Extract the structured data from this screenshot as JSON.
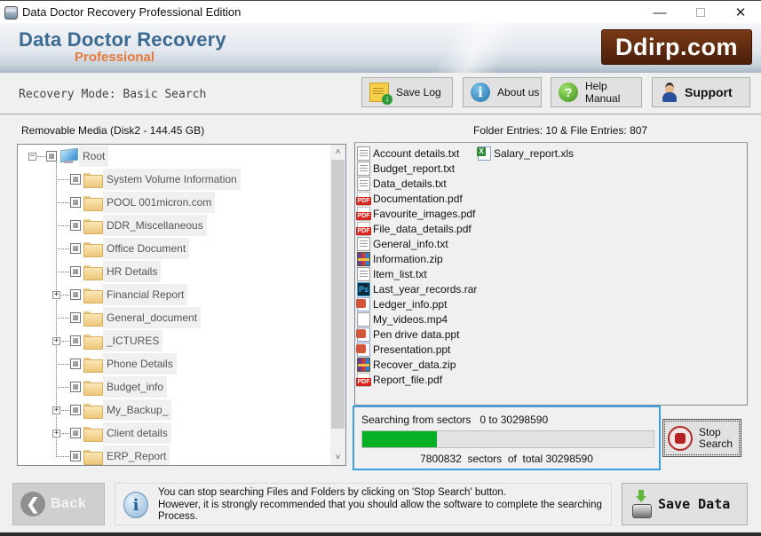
{
  "window": {
    "title": "Data Doctor Recovery Professional Edition",
    "controls": {
      "minimize": "—",
      "close": "✕"
    }
  },
  "banner": {
    "brand_main": "Data Doctor Recovery",
    "brand_sub": "Professional",
    "site_badge": "Ddirp.com"
  },
  "toolbar": {
    "mode_label": "Recovery Mode: Basic Search",
    "save_log": "Save Log",
    "about_us": "About us",
    "help_manual": "Help Manual",
    "support": "Support",
    "icons": {
      "save_log": "document-download-icon",
      "about_us": "info-icon",
      "help_manual": "help-icon",
      "support": "support-person-icon"
    }
  },
  "tree": {
    "header": "Removable Media (Disk2 - 144.45 GB)",
    "root": {
      "label": "Root",
      "expander": "−"
    },
    "items": [
      {
        "label": "System Volume Information",
        "expandable": false
      },
      {
        "label": "POOL 001micron.com",
        "expandable": false
      },
      {
        "label": "DDR_Miscellaneous",
        "expandable": false
      },
      {
        "label": "Office Document",
        "expandable": false
      },
      {
        "label": "HR Details",
        "expandable": false
      },
      {
        "label": "Financial Report",
        "expandable": true
      },
      {
        "label": "General_document",
        "expandable": false
      },
      {
        "label": "_ICTURES",
        "expandable": true
      },
      {
        "label": "Phone Details",
        "expandable": false
      },
      {
        "label": "Budget_info",
        "expandable": false
      },
      {
        "label": "My_Backup_",
        "expandable": true
      },
      {
        "label": "Client details",
        "expandable": true
      },
      {
        "label": "ERP_Report",
        "expandable": false
      }
    ],
    "expand_glyph": "+",
    "scroll_up": "˄",
    "scroll_down": "˅"
  },
  "files": {
    "summary": "Folder Entries: 10 & File Entries: 807",
    "columns": [
      [
        {
          "name": "Account details.txt",
          "type": "txt"
        },
        {
          "name": "Budget_report.txt",
          "type": "txt"
        },
        {
          "name": "Data_details.txt",
          "type": "txt"
        },
        {
          "name": "Documentation.pdf",
          "type": "pdf"
        },
        {
          "name": "Favourite_images.pdf",
          "type": "pdf"
        },
        {
          "name": "File_data_details.pdf",
          "type": "pdf"
        },
        {
          "name": "General_info.txt",
          "type": "txt"
        },
        {
          "name": "Information.zip",
          "type": "zip"
        },
        {
          "name": "Item_list.txt",
          "type": "txt"
        },
        {
          "name": "Last_year_records.rar",
          "type": "ps"
        },
        {
          "name": "Ledger_info.ppt",
          "type": "ppt"
        },
        {
          "name": "My_videos.mp4",
          "type": "blank"
        },
        {
          "name": "Pen drive data.ppt",
          "type": "ppt"
        },
        {
          "name": "Presentation.ppt",
          "type": "ppt"
        },
        {
          "name": "Recover_data.zip",
          "type": "zip"
        },
        {
          "name": "Report_file.pdf",
          "type": "pdf"
        }
      ],
      [
        {
          "name": "Salary_report.xls",
          "type": "xls"
        }
      ]
    ],
    "ps_glyph": "Ps"
  },
  "progress": {
    "title": "Searching from sectors   0 to 30298590",
    "current_sector": 7800832,
    "total_sectors": 30298590,
    "fraction": 0.2575,
    "detail": "7800832  sectors  of  total 30298590",
    "color": "#06b025"
  },
  "stop_button": {
    "label": "Stop Search"
  },
  "footer": {
    "back": "Back",
    "back_glyph": "❮",
    "info_glyph": "i",
    "info_lines": [
      "You can stop searching Files and Folders by clicking on 'Stop Search' button.",
      "However, it is strongly recommended that you should allow the software to complete the searching",
      "Process."
    ],
    "save_data": "Save Data"
  }
}
